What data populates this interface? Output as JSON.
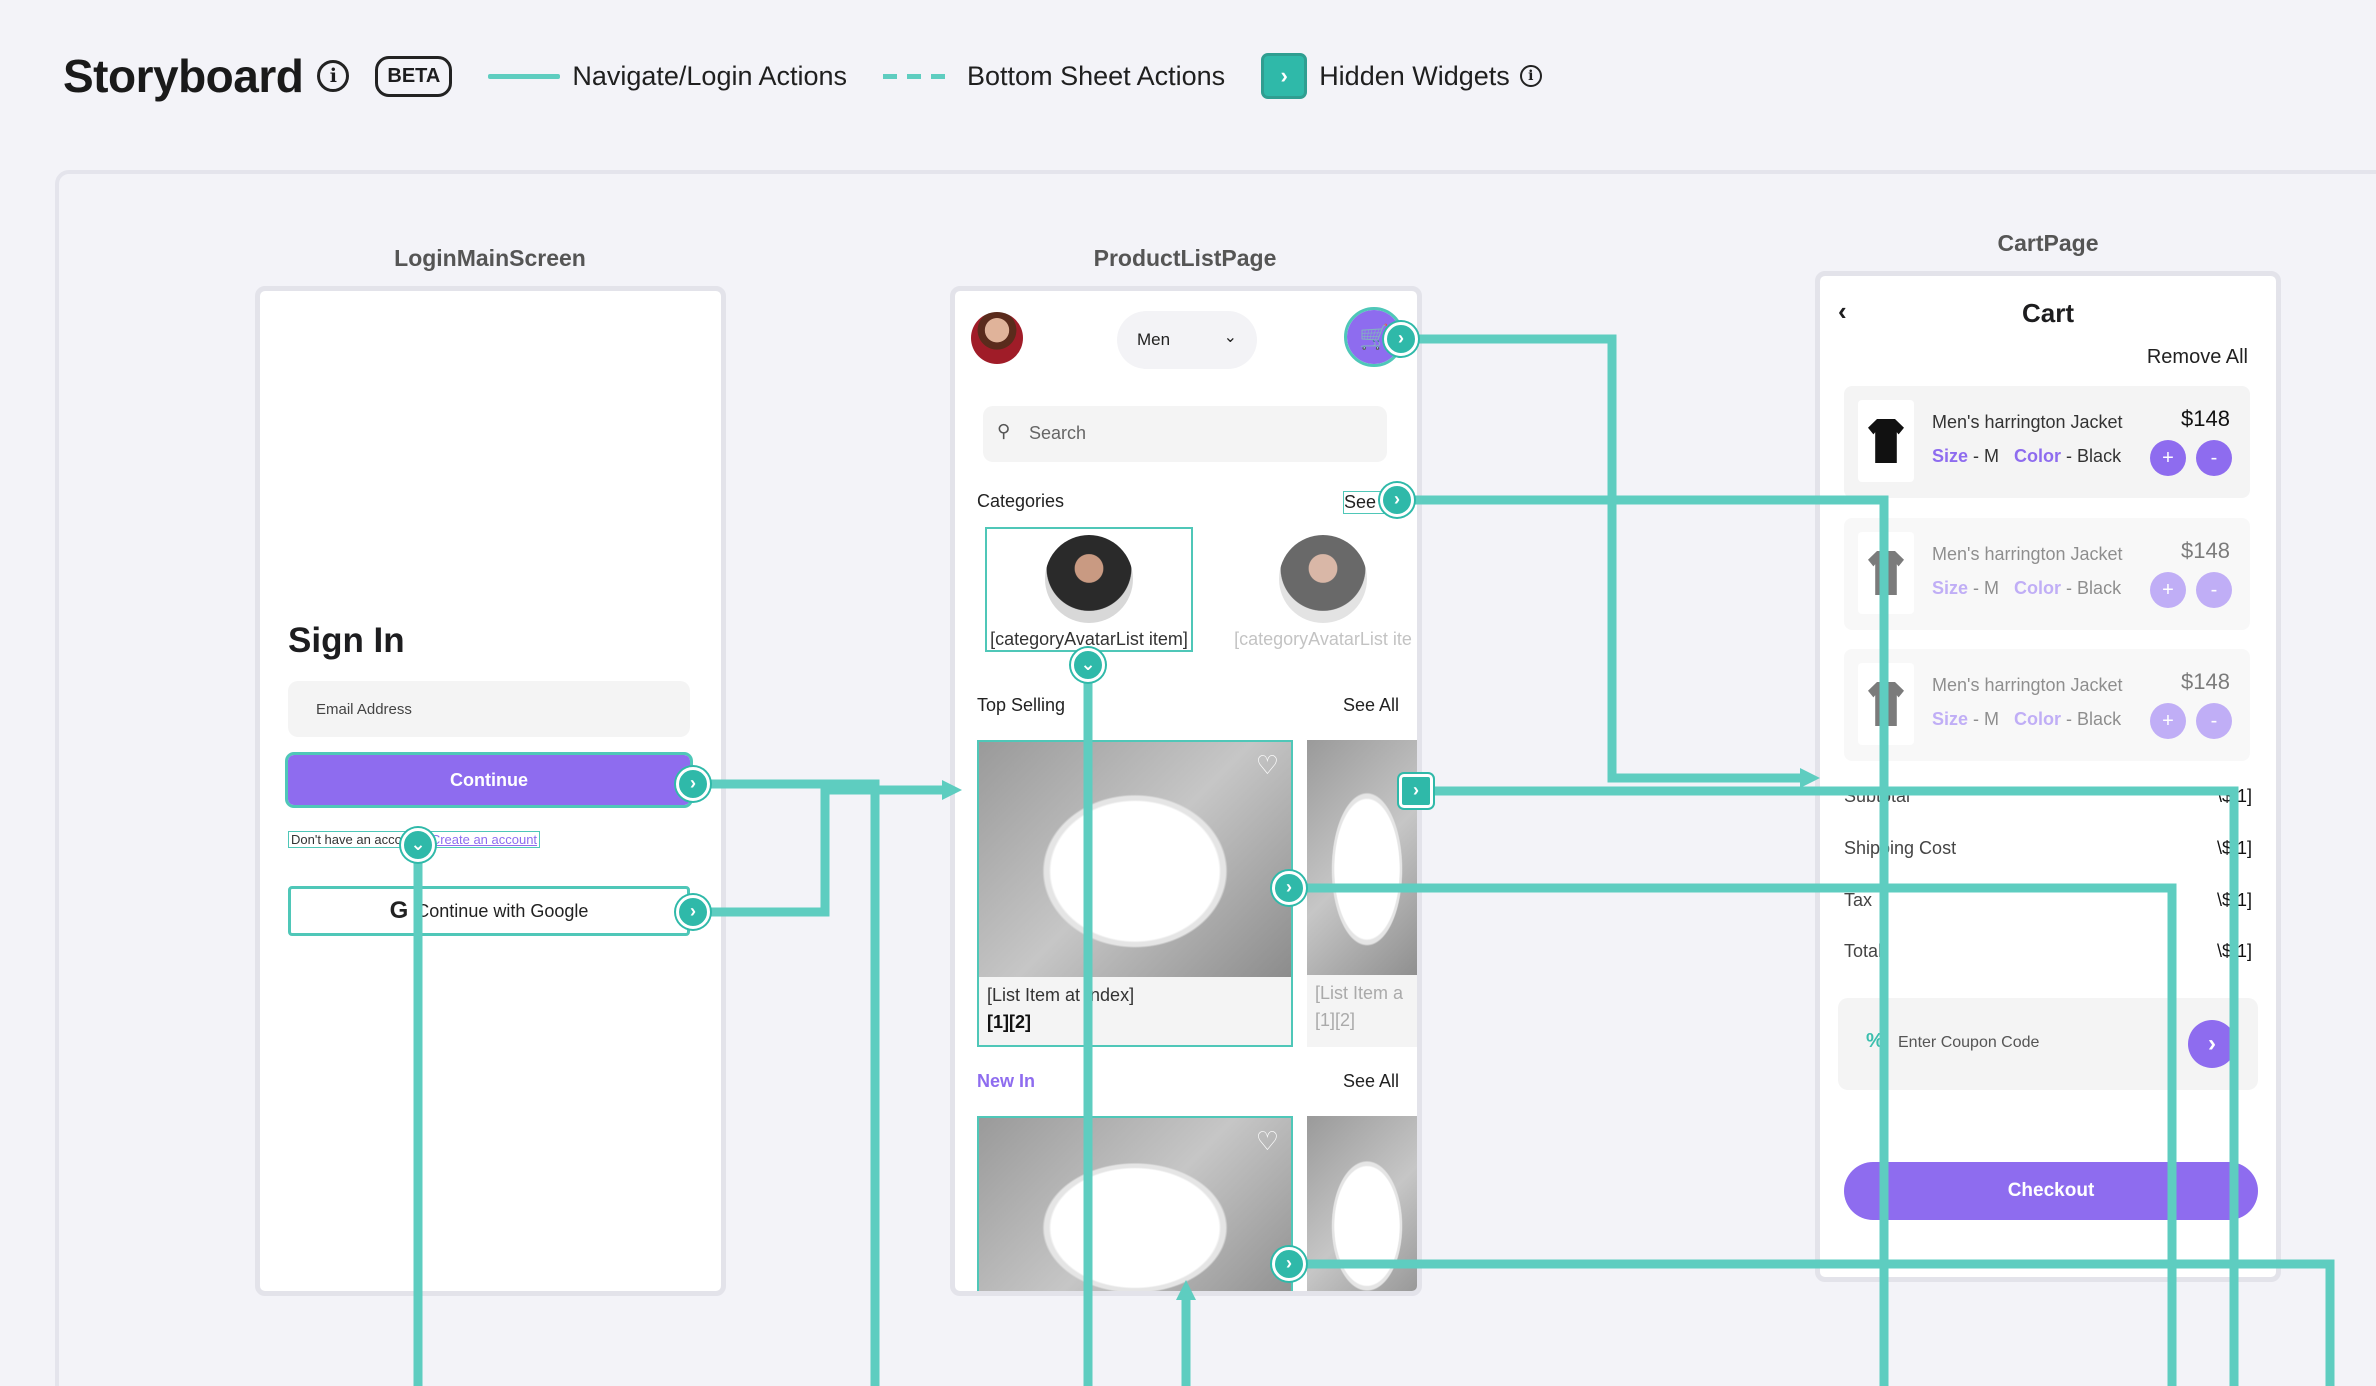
{
  "header": {
    "title": "Storyboard",
    "badge": "BETA",
    "legend": {
      "navigate": "Navigate/Login Actions",
      "bottom_sheet": "Bottom Sheet Actions",
      "hidden": "Hidden Widgets"
    }
  },
  "colors": {
    "connector": "#5ecdc0",
    "accent": "#8e6cef",
    "node": "#2fb9a9"
  },
  "screens": {
    "login": {
      "label": "LoginMainScreen",
      "title": "Sign In",
      "email_placeholder": "Email Address",
      "continue": "Continue",
      "no_account": "Don't have an account? ",
      "create_account": "Create an account",
      "google": "Continue with Google"
    },
    "product_list": {
      "label": "ProductListPage",
      "gender": "Men",
      "search_placeholder": "Search",
      "categories_title": "Categories",
      "categories_link": "See All",
      "category_item": "[categoryAvatarList item]",
      "category_item_faded": "[categoryAvatarList ite",
      "top_selling_title": "Top Selling",
      "top_selling_link": "See All",
      "product_name": "[List Item at Index]",
      "product_price": "[1][2]",
      "product_name_faded": "[List Item a",
      "product_price_faded": "[1][2]",
      "new_in_title": "New In",
      "new_in_link": "See All"
    },
    "cart": {
      "label": "CartPage",
      "title": "Cart",
      "remove_all": "Remove All",
      "items": [
        {
          "name": "Men's harrington Jacket",
          "price": "$148",
          "size_label": "Size",
          "size": "M",
          "color_label": "Color",
          "color": "Black"
        },
        {
          "name": "Men's harrington Jacket",
          "price": "$148",
          "size_label": "Size",
          "size": "M",
          "color_label": "Color",
          "color": "Black"
        },
        {
          "name": "Men's harrington Jacket",
          "price": "$148",
          "size_label": "Size",
          "size": "M",
          "color_label": "Color",
          "color": "Black"
        }
      ],
      "summary": [
        {
          "label": "Subtotal",
          "value": "\\$[1]"
        },
        {
          "label": "Shipping Cost",
          "value": "\\$[1]"
        },
        {
          "label": "Tax",
          "value": "\\$[1]"
        },
        {
          "label": "Total",
          "value": "\\$[1]"
        }
      ],
      "coupon_placeholder": "Enter Coupon Code",
      "checkout": "Checkout"
    }
  }
}
